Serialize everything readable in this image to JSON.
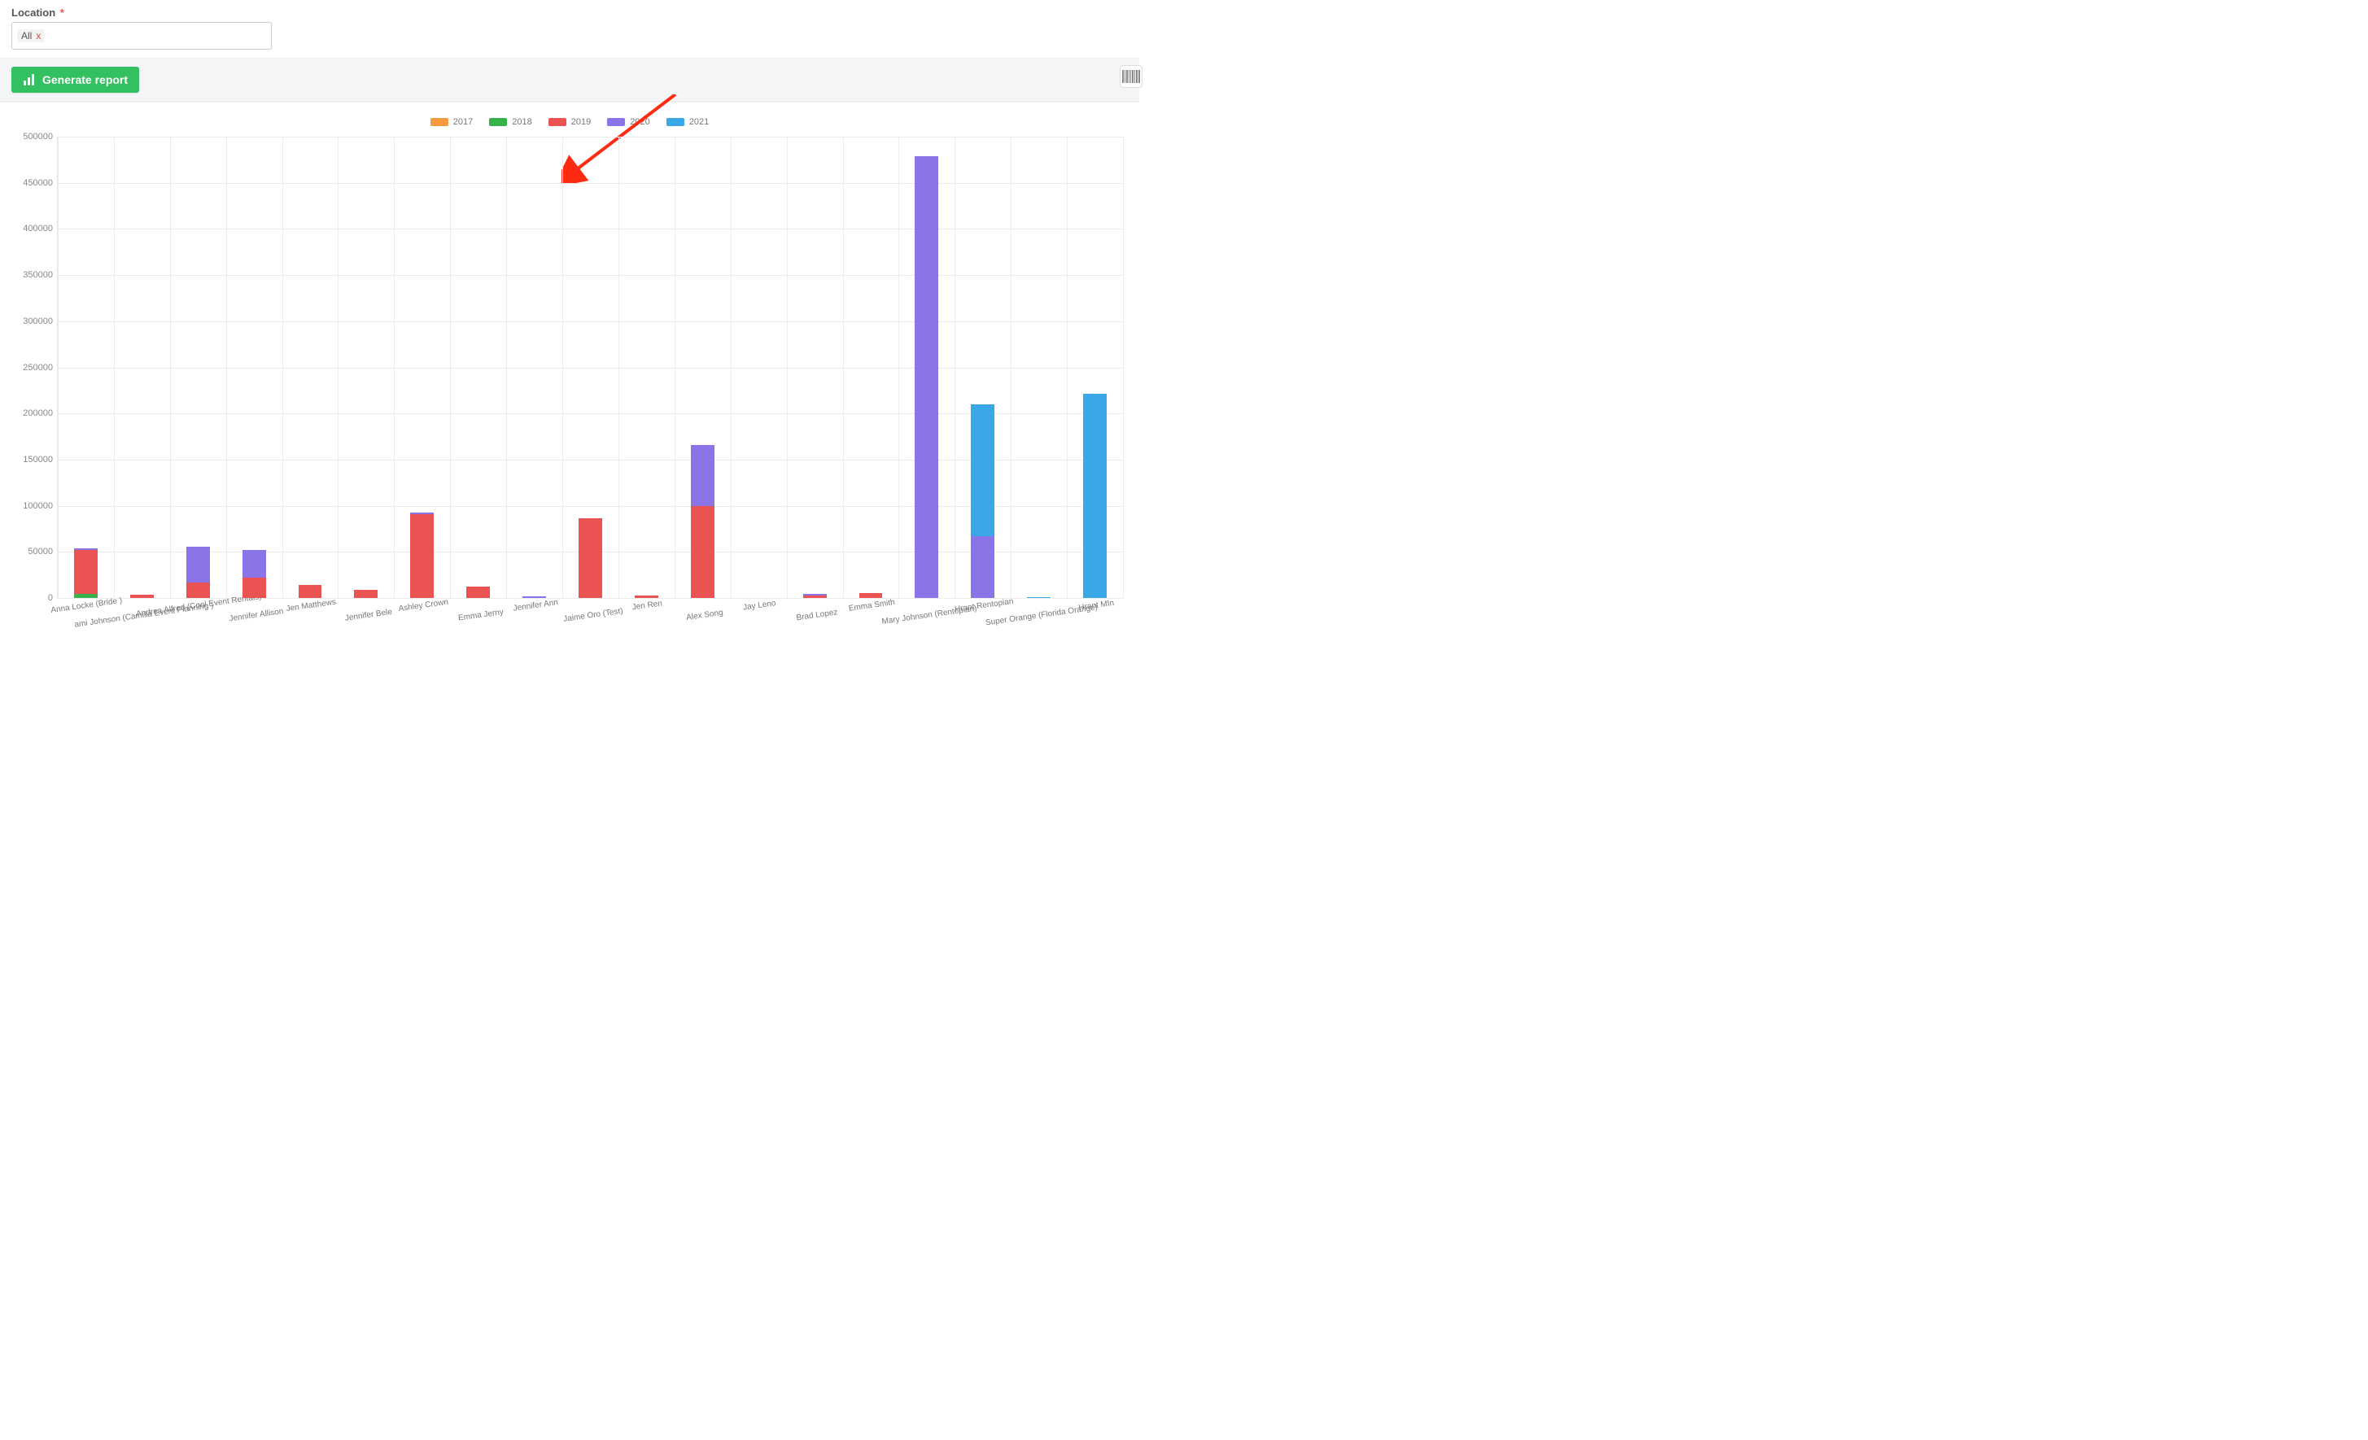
{
  "filter": {
    "label": "Location",
    "required_marker": "*",
    "selected_tag": "All",
    "tag_close_glyph": "x"
  },
  "buttons": {
    "generate": "Generate report"
  },
  "colors": {
    "2017": "#f59a3e",
    "2018": "#38b24b",
    "2019": "#ea5352",
    "2020": "#8b74e8",
    "2021": "#3aa8e6"
  },
  "annotation": {
    "target": "legend",
    "type": "arrow",
    "color": "#ff2a12"
  },
  "chart_data": {
    "type": "bar",
    "stacked": true,
    "ylabel": "",
    "xlabel": "",
    "ylim": [
      0,
      500000
    ],
    "yticks": [
      0,
      50000,
      100000,
      150000,
      200000,
      250000,
      300000,
      350000,
      400000,
      450000,
      500000
    ],
    "legend_position": "top",
    "categories": [
      "Anna Locke (Bride )",
      "ami Johnson  (Camilla Event Planning )",
      "Andrea Alfred (Cool Event Rentals)",
      "Jennifer Allison",
      "Jen  Matthews",
      "Jennifer  Bele",
      "Ashley Crown",
      "Emma Jerny",
      "Jennifer  Ann",
      "Jaime  Oro (Test)",
      "Jen Ren",
      "Alex Song",
      "Jay Leno",
      "Brad Lopez",
      "Emma Smith",
      "Mary Johnson (Rentopian)",
      "Hrant Rentopian",
      "Super Orange (Florida Orange)",
      "Hrant MIn"
    ],
    "series": [
      {
        "name": "2017",
        "values": [
          0,
          0,
          0,
          0,
          0,
          0,
          0,
          0,
          0,
          0,
          0,
          0,
          0,
          0,
          0,
          0,
          0,
          0,
          0
        ]
      },
      {
        "name": "2018",
        "values": [
          4000,
          0,
          0,
          0,
          0,
          0,
          0,
          0,
          0,
          0,
          0,
          0,
          0,
          0,
          0,
          0,
          0,
          0,
          0
        ]
      },
      {
        "name": "2019",
        "values": [
          48000,
          3500,
          17000,
          22000,
          14000,
          9000,
          91000,
          12000,
          0,
          86000,
          2500,
          100000,
          0,
          3000,
          5000,
          0,
          0,
          0,
          0
        ]
      },
      {
        "name": "2020",
        "values": [
          1500,
          0,
          39000,
          30000,
          0,
          0,
          2000,
          0,
          1500,
          0,
          0,
          66000,
          0,
          1000,
          0,
          479000,
          67000,
          0,
          0
        ]
      },
      {
        "name": "2021",
        "values": [
          0,
          0,
          0,
          0,
          0,
          0,
          0,
          0,
          0,
          0,
          0,
          0,
          0,
          0,
          0,
          0,
          143000,
          1000,
          221000
        ]
      }
    ]
  }
}
